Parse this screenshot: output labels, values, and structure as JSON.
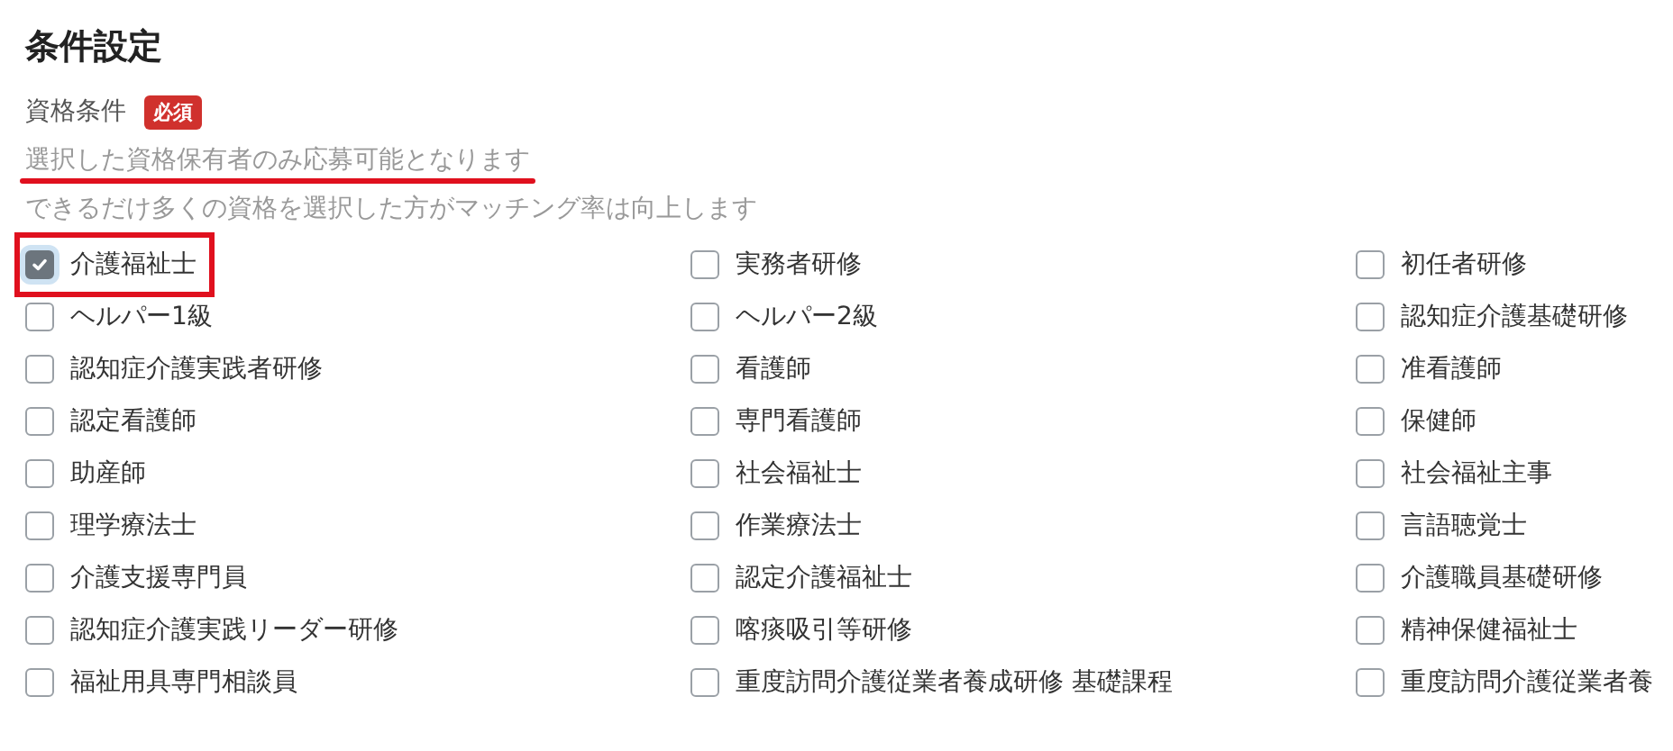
{
  "section_title": "条件設定",
  "field": {
    "label": "資格条件",
    "badge": "必須"
  },
  "hints": [
    {
      "text": "選択した資格保有者のみ応募可能となります",
      "underlined": true
    },
    {
      "text": "できるだけ多くの資格を選択した方がマッチング率は向上します",
      "underlined": false
    }
  ],
  "options": [
    {
      "label": "介護福祉士",
      "checked": true,
      "highlighted": true
    },
    {
      "label": "実務者研修",
      "checked": false,
      "highlighted": false
    },
    {
      "label": "初任者研修",
      "checked": false,
      "highlighted": false
    },
    {
      "label": "ヘルパー1級",
      "checked": false,
      "highlighted": false
    },
    {
      "label": "ヘルパー2級",
      "checked": false,
      "highlighted": false
    },
    {
      "label": "認知症介護基礎研修",
      "checked": false,
      "highlighted": false
    },
    {
      "label": "認知症介護実践者研修",
      "checked": false,
      "highlighted": false
    },
    {
      "label": "看護師",
      "checked": false,
      "highlighted": false
    },
    {
      "label": "准看護師",
      "checked": false,
      "highlighted": false
    },
    {
      "label": "認定看護師",
      "checked": false,
      "highlighted": false
    },
    {
      "label": "専門看護師",
      "checked": false,
      "highlighted": false
    },
    {
      "label": "保健師",
      "checked": false,
      "highlighted": false
    },
    {
      "label": "助産師",
      "checked": false,
      "highlighted": false
    },
    {
      "label": "社会福祉士",
      "checked": false,
      "highlighted": false
    },
    {
      "label": "社会福祉主事",
      "checked": false,
      "highlighted": false
    },
    {
      "label": "理学療法士",
      "checked": false,
      "highlighted": false
    },
    {
      "label": "作業療法士",
      "checked": false,
      "highlighted": false
    },
    {
      "label": "言語聴覚士",
      "checked": false,
      "highlighted": false
    },
    {
      "label": "介護支援専門員",
      "checked": false,
      "highlighted": false
    },
    {
      "label": "認定介護福祉士",
      "checked": false,
      "highlighted": false
    },
    {
      "label": "介護職員基礎研修",
      "checked": false,
      "highlighted": false
    },
    {
      "label": "認知症介護実践リーダー研修",
      "checked": false,
      "highlighted": false
    },
    {
      "label": "喀痰吸引等研修",
      "checked": false,
      "highlighted": false
    },
    {
      "label": "精神保健福祉士",
      "checked": false,
      "highlighted": false
    },
    {
      "label": "福祉用具専門相談員",
      "checked": false,
      "highlighted": false
    },
    {
      "label": "重度訪問介護従業者養成研修 基礎課程",
      "checked": false,
      "highlighted": false
    },
    {
      "label": "重度訪問介護従業者養",
      "checked": false,
      "highlighted": false
    }
  ]
}
